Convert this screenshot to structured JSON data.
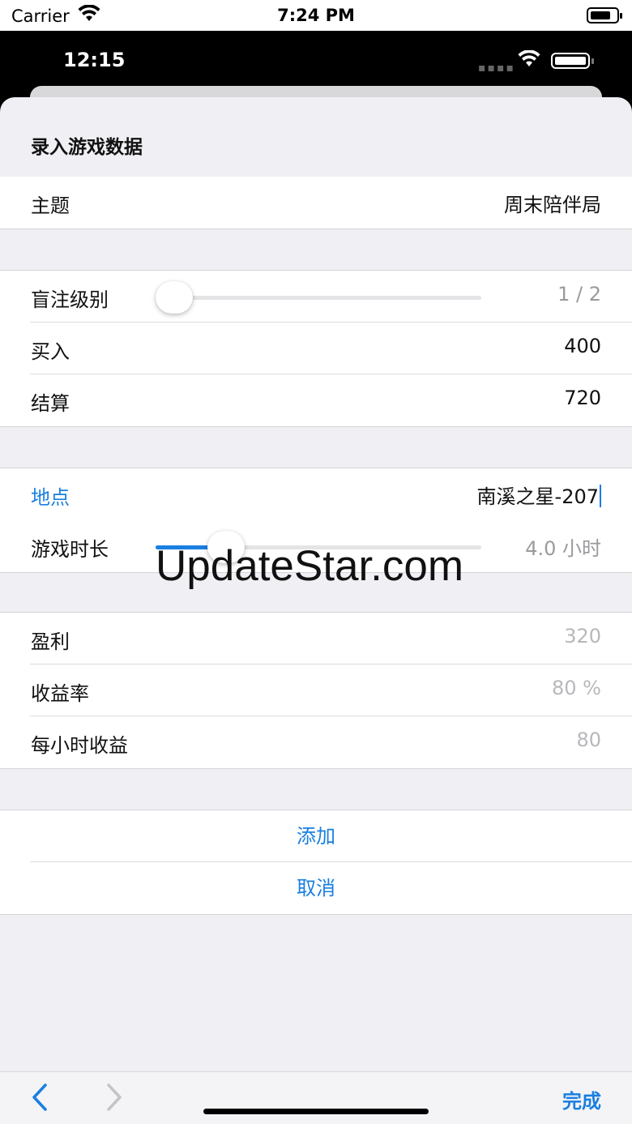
{
  "outer_status": {
    "carrier": "Carrier",
    "time": "7:24 PM"
  },
  "inner_status": {
    "time": "12:15"
  },
  "sheet": {
    "title": "录入游戏数据"
  },
  "theme_row": {
    "label": "主题",
    "value": "周末陪伴局"
  },
  "blind_row": {
    "label": "盲注级别",
    "value": "1 / 2",
    "slider_fraction": 0.0
  },
  "buyin_row": {
    "label": "买入",
    "value": "400"
  },
  "settle_row": {
    "label": "结算",
    "value": "720"
  },
  "location_row": {
    "label": "地点",
    "value": "南溪之星-207"
  },
  "duration_row": {
    "label": "游戏时长",
    "value": "4.0 小时",
    "slider_fraction": 0.18
  },
  "profit_row": {
    "label": "盈利",
    "value": "320"
  },
  "rate_row": {
    "label": "收益率",
    "value": "80 %"
  },
  "hourly_row": {
    "label": "每小时收益",
    "value": "80"
  },
  "actions": {
    "add": "添加",
    "cancel": "取消"
  },
  "toolbar": {
    "done": "完成",
    "back_icon": "chevron-left-icon",
    "forward_icon": "chevron-right-icon"
  },
  "watermark": "UpdateStar.com",
  "colors": {
    "accent": "#1a7fe0",
    "background": "#efeff4"
  }
}
